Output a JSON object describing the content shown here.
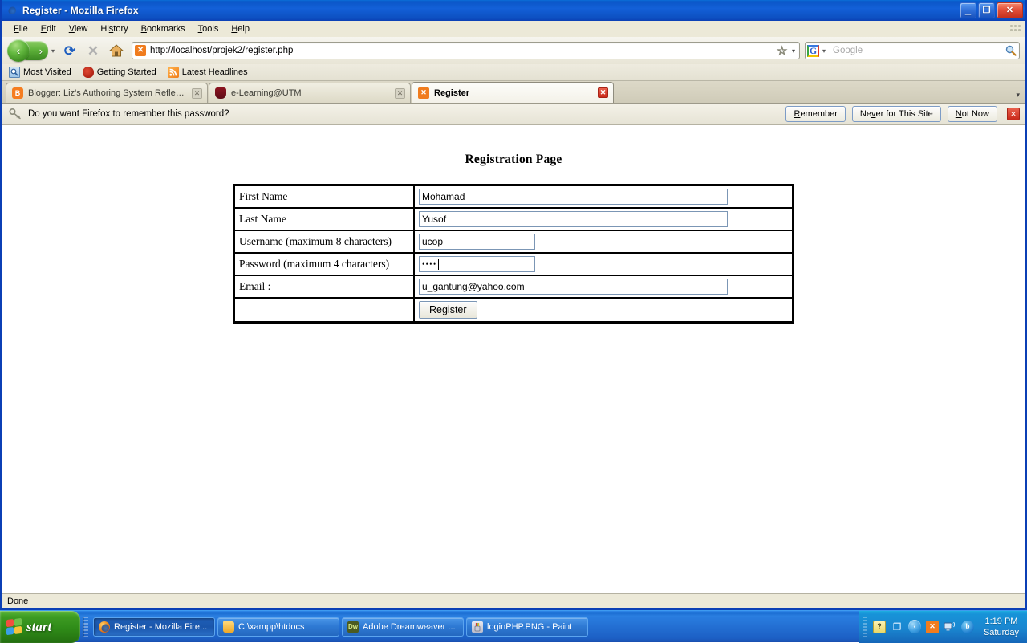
{
  "window": {
    "title": "Register - Mozilla Firefox",
    "app_icon": "firefox-logo-icon",
    "controls": {
      "minimize": "_",
      "restore": "❐",
      "close": "✕"
    }
  },
  "menubar": {
    "items": [
      {
        "label": "File",
        "accesskey": "F"
      },
      {
        "label": "Edit",
        "accesskey": "E"
      },
      {
        "label": "View",
        "accesskey": "V"
      },
      {
        "label": "History",
        "accesskey": "s"
      },
      {
        "label": "Bookmarks",
        "accesskey": "B"
      },
      {
        "label": "Tools",
        "accesskey": "T"
      },
      {
        "label": "Help",
        "accesskey": "H"
      }
    ]
  },
  "navbar": {
    "back_label": "‹",
    "forward_label": "›",
    "dropdown_label": "▾",
    "reload_label": "⟳",
    "stop_label": "✕",
    "home_label": "⌂",
    "url": "http://localhost/projek2/register.php",
    "favicon": "xampp-favicon-icon",
    "favicon_glyph": "✕",
    "bookmark_star": "☆",
    "url_dropdown": "▾",
    "search": {
      "engine": "G",
      "engine_dropdown": "▾",
      "placeholder": "Google",
      "value": "",
      "submit_icon": "magnifier-icon"
    }
  },
  "bookmarks_toolbar": {
    "items": [
      {
        "label": "Most Visited",
        "icon": "most-visited-icon",
        "glyph": "⚲"
      },
      {
        "label": "Getting Started",
        "icon": "dragon-head-icon",
        "glyph": ""
      },
      {
        "label": "Latest Headlines",
        "icon": "rss-feed-icon",
        "glyph": "◔"
      }
    ]
  },
  "tabs": {
    "list": [
      {
        "label": "Blogger: Liz's Authoring System Reflecti...",
        "icon": "blogger-icon",
        "icon_glyph": "B",
        "active": false,
        "close_glyph": "✕"
      },
      {
        "label": "e-Learning@UTM",
        "icon": "utm-icon",
        "icon_glyph": "",
        "active": false,
        "close_glyph": "✕"
      },
      {
        "label": "Register",
        "icon": "xampp-icon",
        "icon_glyph": "✕",
        "active": true,
        "close_glyph": "✕"
      }
    ],
    "list_all_button": "▾"
  },
  "notification": {
    "icon": "key-icon",
    "message": "Do you want Firefox to remember this password?",
    "buttons": [
      {
        "label": "Remember",
        "accesskey": "R"
      },
      {
        "label": "Never for This Site",
        "accesskey": "v"
      },
      {
        "label": "Not Now",
        "accesskey": "N"
      }
    ],
    "close_glyph": "✕"
  },
  "page": {
    "heading": "Registration Page",
    "form": {
      "rows": [
        {
          "label": "First Name",
          "value": "Mohamad",
          "field": "text",
          "width": "long"
        },
        {
          "label": "Last Name",
          "value": "Yusof",
          "field": "text",
          "width": "long"
        },
        {
          "label": "Username (maximum 8 characters)",
          "value": "ucop",
          "field": "text",
          "width": "short"
        },
        {
          "label": "Password (maximum 4 characters)",
          "value": "••••",
          "field": "password",
          "width": "short",
          "focused": true
        },
        {
          "label": "Email :",
          "value": "u_gantung@yahoo.com",
          "field": "text",
          "width": "long"
        }
      ],
      "submit_label": "Register"
    }
  },
  "statusbar": {
    "text": "Done"
  },
  "taskbar": {
    "start_label": "start",
    "tasks": [
      {
        "label": "Register - Mozilla Fire...",
        "icon": "firefox-icon",
        "icon_glyph": "",
        "active": true
      },
      {
        "label": "C:\\xampp\\htdocs",
        "icon": "folder-icon",
        "icon_glyph": "",
        "active": false
      },
      {
        "label": "Adobe Dreamweaver ...",
        "icon": "dreamweaver-icon",
        "icon_glyph": "Dw",
        "active": false
      },
      {
        "label": "loginPHP.PNG - Paint",
        "icon": "paint-icon",
        "icon_glyph": "",
        "active": false
      }
    ],
    "tray": [
      {
        "name": "help-icon",
        "glyph": "?"
      },
      {
        "name": "window-icon",
        "glyph": "❐"
      },
      {
        "name": "show-hidden-icons-icon",
        "glyph": "‹"
      },
      {
        "name": "xampp-tray-icon",
        "glyph": "✕"
      },
      {
        "name": "network-monitor-icon",
        "glyph": "▣"
      },
      {
        "name": "browser-globe-icon",
        "glyph": "b"
      }
    ],
    "clock": {
      "time": "1:19 PM",
      "day": "Saturday"
    }
  },
  "colors": {
    "titlebar_blue": "#0b3fb5",
    "taskbar_blue": "#1d6fd4",
    "start_green": "#3d9b22",
    "accent_orange": "#f07c1e",
    "close_red": "#c9291a"
  }
}
